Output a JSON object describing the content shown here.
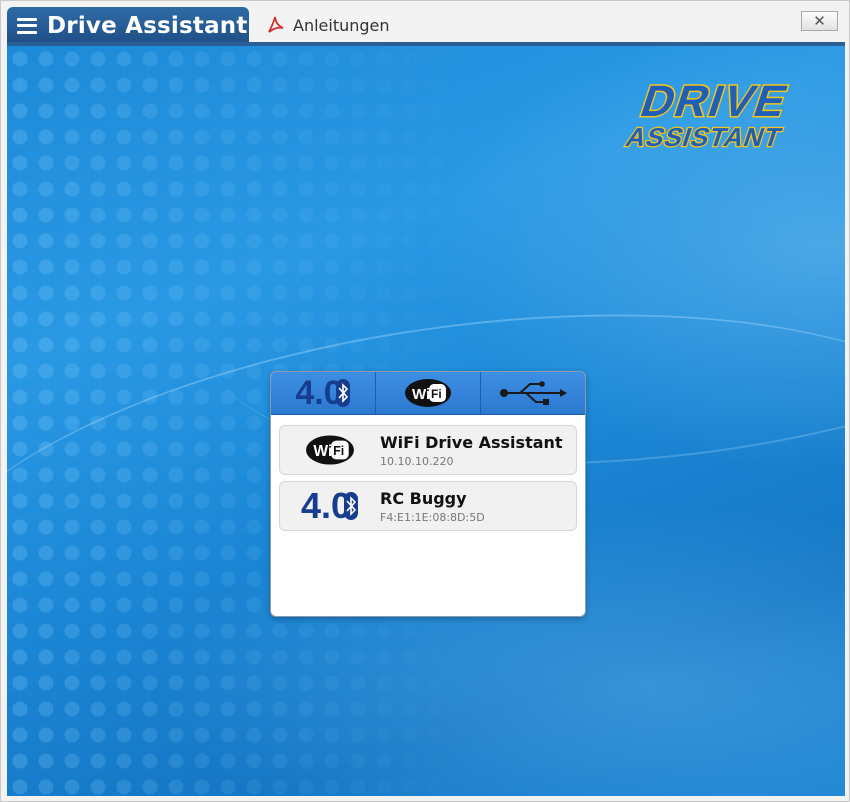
{
  "window": {
    "title": "Drive Assistant",
    "docs_tab_label": "Anleitungen",
    "close_label": "✕"
  },
  "logo": {
    "line1": "DRIVE",
    "line2": "ASSISTANT"
  },
  "connection_tabs": [
    {
      "icon": "bluetooth-4-icon",
      "label": "4.0"
    },
    {
      "icon": "wifi-icon",
      "label": "Wi Fi"
    },
    {
      "icon": "usb-icon",
      "label": ""
    }
  ],
  "devices": [
    {
      "icon": "wifi-icon",
      "name": "WiFi Drive Assistant",
      "address": "10.10.10.220"
    },
    {
      "icon": "bluetooth-4-icon",
      "badge": "4.0",
      "name": "RC Buggy",
      "address": "F4:E1:1E:08:8D:5D"
    }
  ],
  "colors": {
    "accent": "#2a5e95",
    "background_blue": "#1d8ad8",
    "logo_blue": "#1f5fb8",
    "logo_yellow": "#f5c518"
  }
}
